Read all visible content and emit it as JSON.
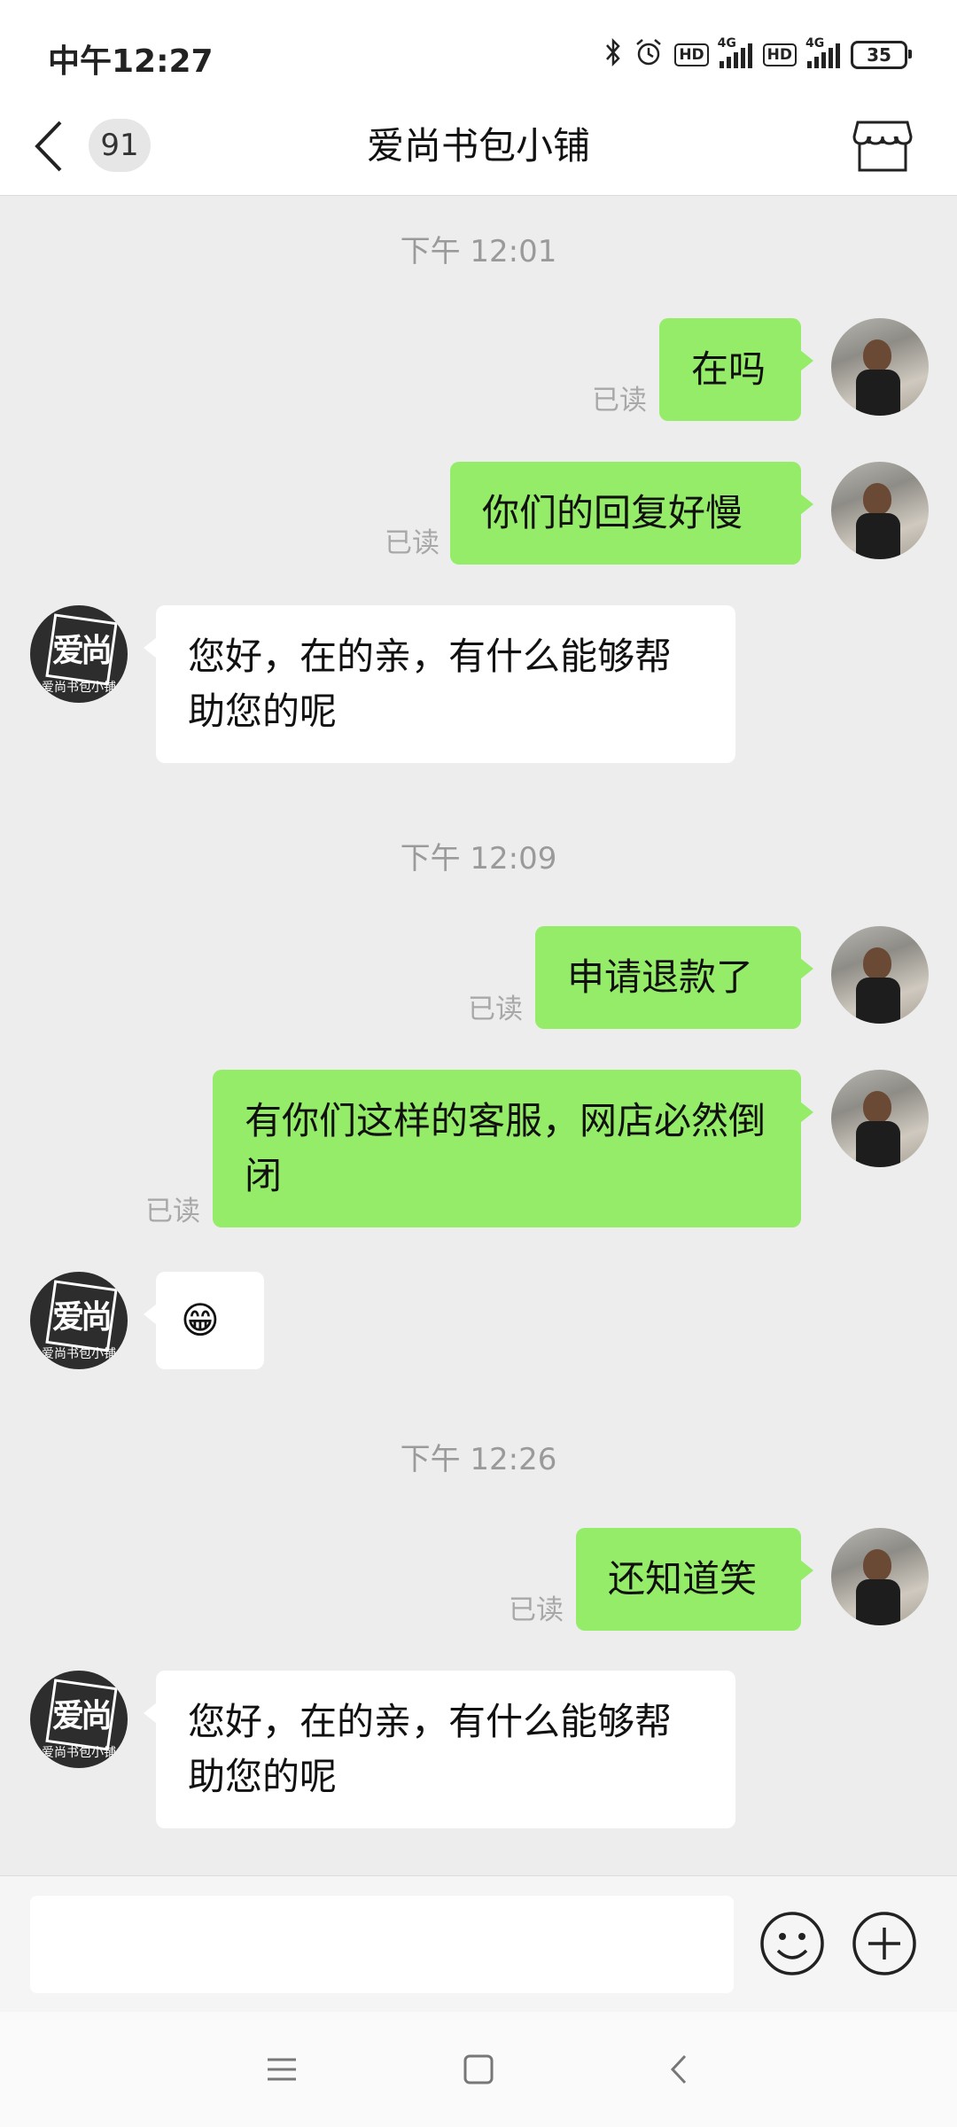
{
  "status_bar": {
    "time": "中午12:27",
    "hd1": "HD",
    "hd2": "HD",
    "net1": "4G",
    "net2": "4G",
    "battery": "35"
  },
  "header": {
    "unread_count": "91",
    "title": "爱尚书包小铺"
  },
  "shop_avatar": {
    "glyph": "爱尚",
    "caption": "爱尚书包小铺"
  },
  "chat": {
    "read_label": "已读",
    "times": [
      "下午 12:01",
      "下午 12:09",
      "下午 12:26"
    ],
    "messages": [
      {
        "from": "me",
        "text": "在吗"
      },
      {
        "from": "me",
        "text": "你们的回复好慢"
      },
      {
        "from": "shop",
        "text": "您好，在的亲，有什么能够帮助您的呢"
      },
      {
        "from": "me",
        "text": "申请退款了"
      },
      {
        "from": "me",
        "text": "有你们这样的客服，网店必然倒闭"
      },
      {
        "from": "shop",
        "text": "😁"
      },
      {
        "from": "me",
        "text": "还知道笑"
      },
      {
        "from": "shop",
        "text": "您好，在的亲，有什么能够帮助您的呢"
      }
    ]
  },
  "input": {
    "value": ""
  },
  "icons": [
    "back-icon",
    "store-icon",
    "emoji-icon",
    "plus-icon",
    "menu-icon",
    "home-icon",
    "nav-back-icon"
  ]
}
